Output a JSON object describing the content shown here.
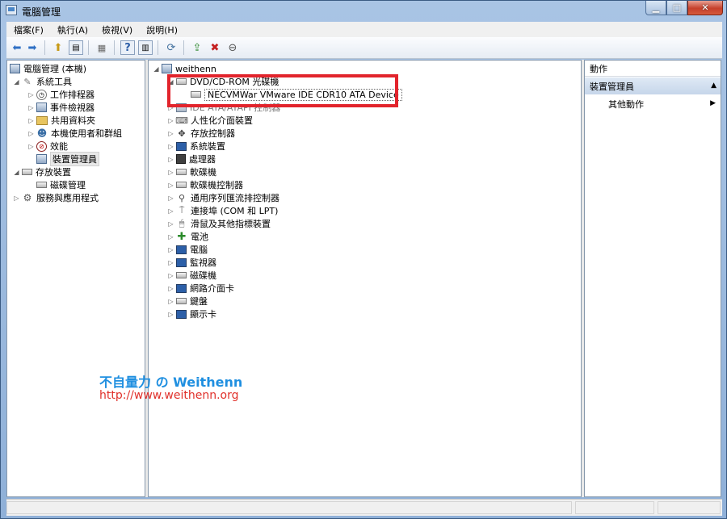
{
  "window": {
    "title": "電腦管理",
    "min_glyph": "▁",
    "max_glyph": "□",
    "close_glyph": "✕"
  },
  "menu": [
    "檔案(F)",
    "執行(A)",
    "檢視(V)",
    "說明(H)"
  ],
  "toolbar_icons": [
    "back-icon",
    "forward-icon",
    "up-icon",
    "show-hide-tree-icon",
    "properties-icon",
    "help-icon",
    "show-hide-action-icon",
    "scan-hardware-icon",
    "update-driver-icon",
    "disable-device-icon",
    "uninstall-icon"
  ],
  "left_tree": [
    {
      "label": "電腦管理 (本機)",
      "level": 0,
      "expander": "",
      "icon": "comp"
    },
    {
      "label": "系統工具",
      "level": 1,
      "expander": "◢",
      "icon": "tools"
    },
    {
      "label": "工作排程器",
      "level": 2,
      "expander": "▷",
      "icon": "clock"
    },
    {
      "label": "事件檢視器",
      "level": 2,
      "expander": "▷",
      "icon": "event"
    },
    {
      "label": "共用資料夾",
      "level": 2,
      "expander": "▷",
      "icon": "folder"
    },
    {
      "label": "本機使用者和群組",
      "level": 2,
      "expander": "▷",
      "icon": "users"
    },
    {
      "label": "效能",
      "level": 2,
      "expander": "▷",
      "icon": "perf"
    },
    {
      "label": "裝置管理員",
      "level": 2,
      "expander": "",
      "icon": "devmgr",
      "selected": true
    },
    {
      "label": "存放裝置",
      "level": 1,
      "expander": "◢",
      "icon": "storage"
    },
    {
      "label": "磁碟管理",
      "level": 2,
      "expander": "",
      "icon": "disk"
    },
    {
      "label": "服務與應用程式",
      "level": 1,
      "expander": "▷",
      "icon": "svc"
    }
  ],
  "device_tree": {
    "root": "weithenn",
    "highlighted_category": "DVD/CD-ROM 光碟機",
    "highlighted_device": "NECVMWar VMware IDE CDR10 ATA Device",
    "partially_hidden_category": "IDE ATA/ATAPI 控制器",
    "categories": [
      "人性化介面裝置",
      "存放控制器",
      "系統裝置",
      "處理器",
      "軟碟機",
      "軟碟機控制器",
      "通用序列匯流排控制器",
      "連接埠 (COM 和 LPT)",
      "滑鼠及其他指標裝置",
      "電池",
      "電腦",
      "監視器",
      "磁碟機",
      "網路介面卡",
      "鍵盤",
      "顯示卡"
    ]
  },
  "watermark": {
    "line1": "不自量力 の Weithenn",
    "line2": "http://www.weithenn.org"
  },
  "actions": {
    "header": "動作",
    "section": "裝置管理員",
    "item": "其他動作"
  },
  "colors": {
    "highlight_box": "#e2242c",
    "watermark_blue": "#1f8fe0",
    "watermark_red": "#e0302a"
  }
}
